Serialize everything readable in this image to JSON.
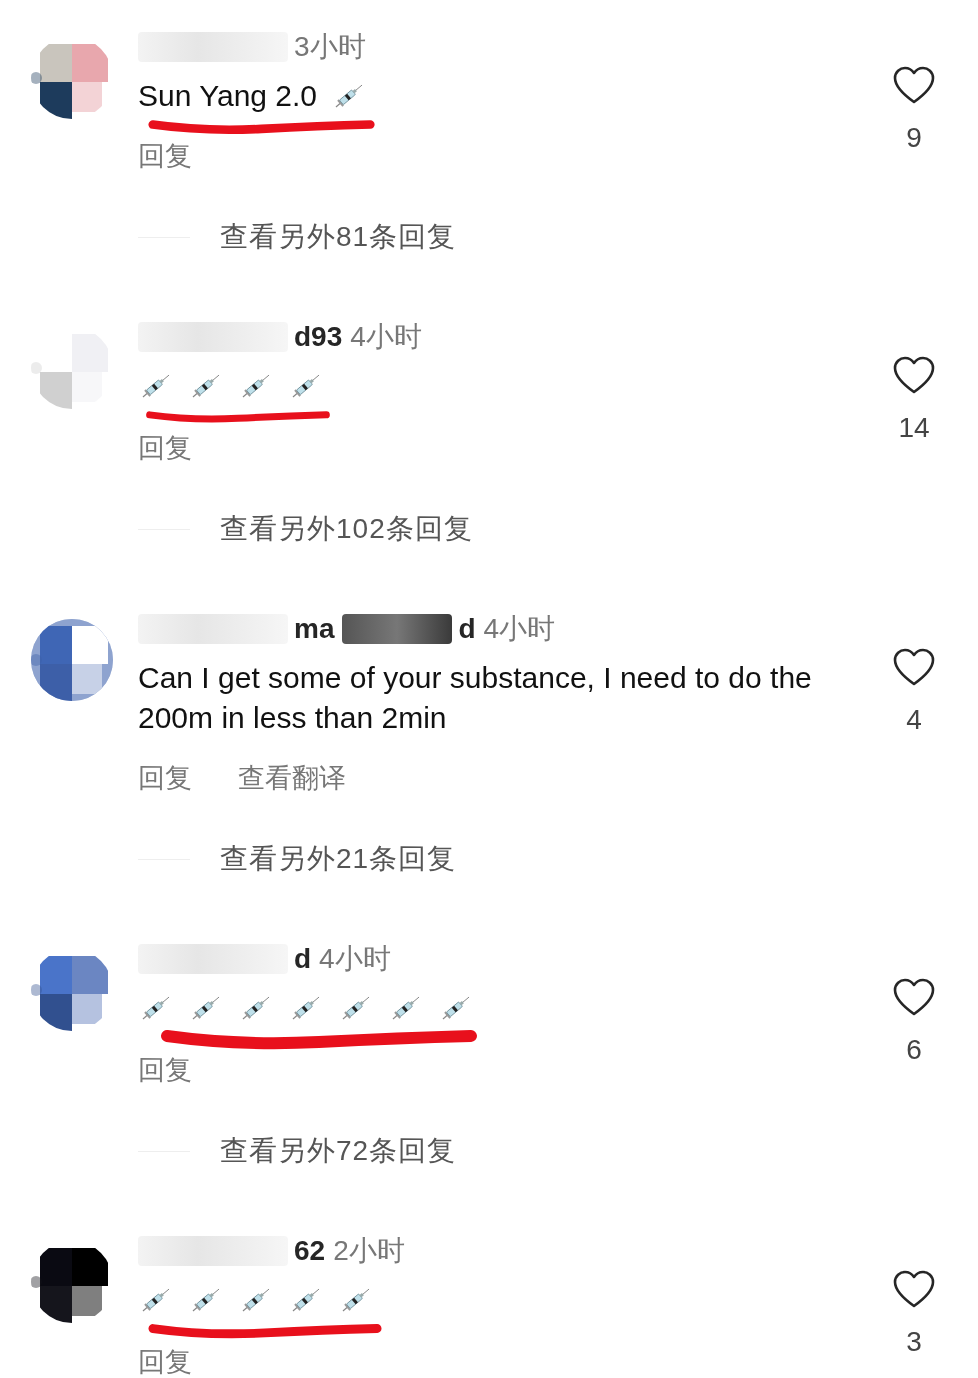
{
  "comments": [
    {
      "avatar": {
        "kind": "picture"
      },
      "time": "3小时",
      "body": [
        {
          "kind": "text",
          "text": "Sun Yang 2.0"
        },
        {
          "kind": "syringe"
        }
      ],
      "highlighted": true,
      "reply": "回复",
      "likes": "9",
      "view_replies": "查看另外81条回复"
    },
    {
      "avatar": {
        "kind": "picture"
      },
      "username_visible": "d93",
      "time": "4小时",
      "body": [
        {
          "kind": "syringe"
        },
        {
          "kind": "syringe"
        },
        {
          "kind": "syringe"
        },
        {
          "kind": "syringe"
        }
      ],
      "highlighted": true,
      "reply": "回复",
      "likes": "14",
      "view_replies": "查看另外102条回复"
    },
    {
      "avatar": {
        "kind": "picture"
      },
      "username_visible": "ma",
      "username_tail": "d",
      "time": "4小时",
      "body": [
        {
          "kind": "text",
          "text": "Can I get some of your substance, I need to do the 200m in less than 2min"
        }
      ],
      "reply": "回复",
      "translate": "查看翻译",
      "likes": "4",
      "view_replies": "查看另外21条回复"
    },
    {
      "avatar": {
        "kind": "picture"
      },
      "username_tail": "d",
      "time": "4小时",
      "body": [
        {
          "kind": "syringe"
        },
        {
          "kind": "syringe"
        },
        {
          "kind": "syringe"
        },
        {
          "kind": "syringe"
        },
        {
          "kind": "syringe"
        },
        {
          "kind": "syringe"
        },
        {
          "kind": "syringe"
        }
      ],
      "highlighted": true,
      "reply": "回复",
      "likes": "6",
      "view_replies": "查看另外72条回复"
    },
    {
      "avatar": {
        "kind": "picture"
      },
      "username_tail": "62",
      "time": "2小时",
      "body": [
        {
          "kind": "syringe"
        },
        {
          "kind": "syringe"
        },
        {
          "kind": "syringe"
        },
        {
          "kind": "syringe"
        },
        {
          "kind": "syringe"
        }
      ],
      "highlighted": true,
      "reply": "回复",
      "likes": "3"
    }
  ]
}
